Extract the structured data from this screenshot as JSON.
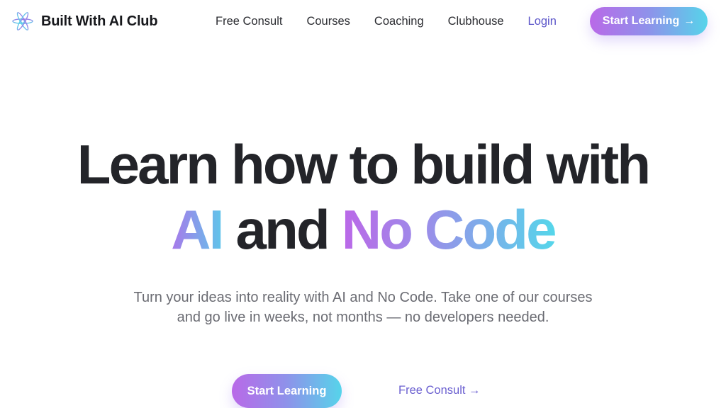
{
  "brand": {
    "name": "Built With AI Club",
    "logo_icon": "atom-star-icon"
  },
  "nav": {
    "links": [
      {
        "label": "Free Consult"
      },
      {
        "label": "Courses"
      },
      {
        "label": "Coaching"
      },
      {
        "label": "Clubhouse"
      }
    ],
    "login_label": "Login",
    "cta_label": "Start Learning",
    "cta_arrow": "→"
  },
  "hero": {
    "title_line1": "Learn how to build with",
    "title_ai": "AI",
    "title_and": " and ",
    "title_nocode": "No Code",
    "subtitle_line1": "Turn your ideas into reality with AI and No Code. Take one of our courses",
    "subtitle_line2": "and go live in weeks, not months — no developers needed.",
    "primary_cta": "Start Learning",
    "secondary_cta": "Free Consult →"
  },
  "colors": {
    "gradient_start": "#b969e8",
    "gradient_mid": "#8e92ea",
    "gradient_end": "#56d4ea",
    "text_dark": "#232429",
    "link_accent": "#5b55c9"
  }
}
